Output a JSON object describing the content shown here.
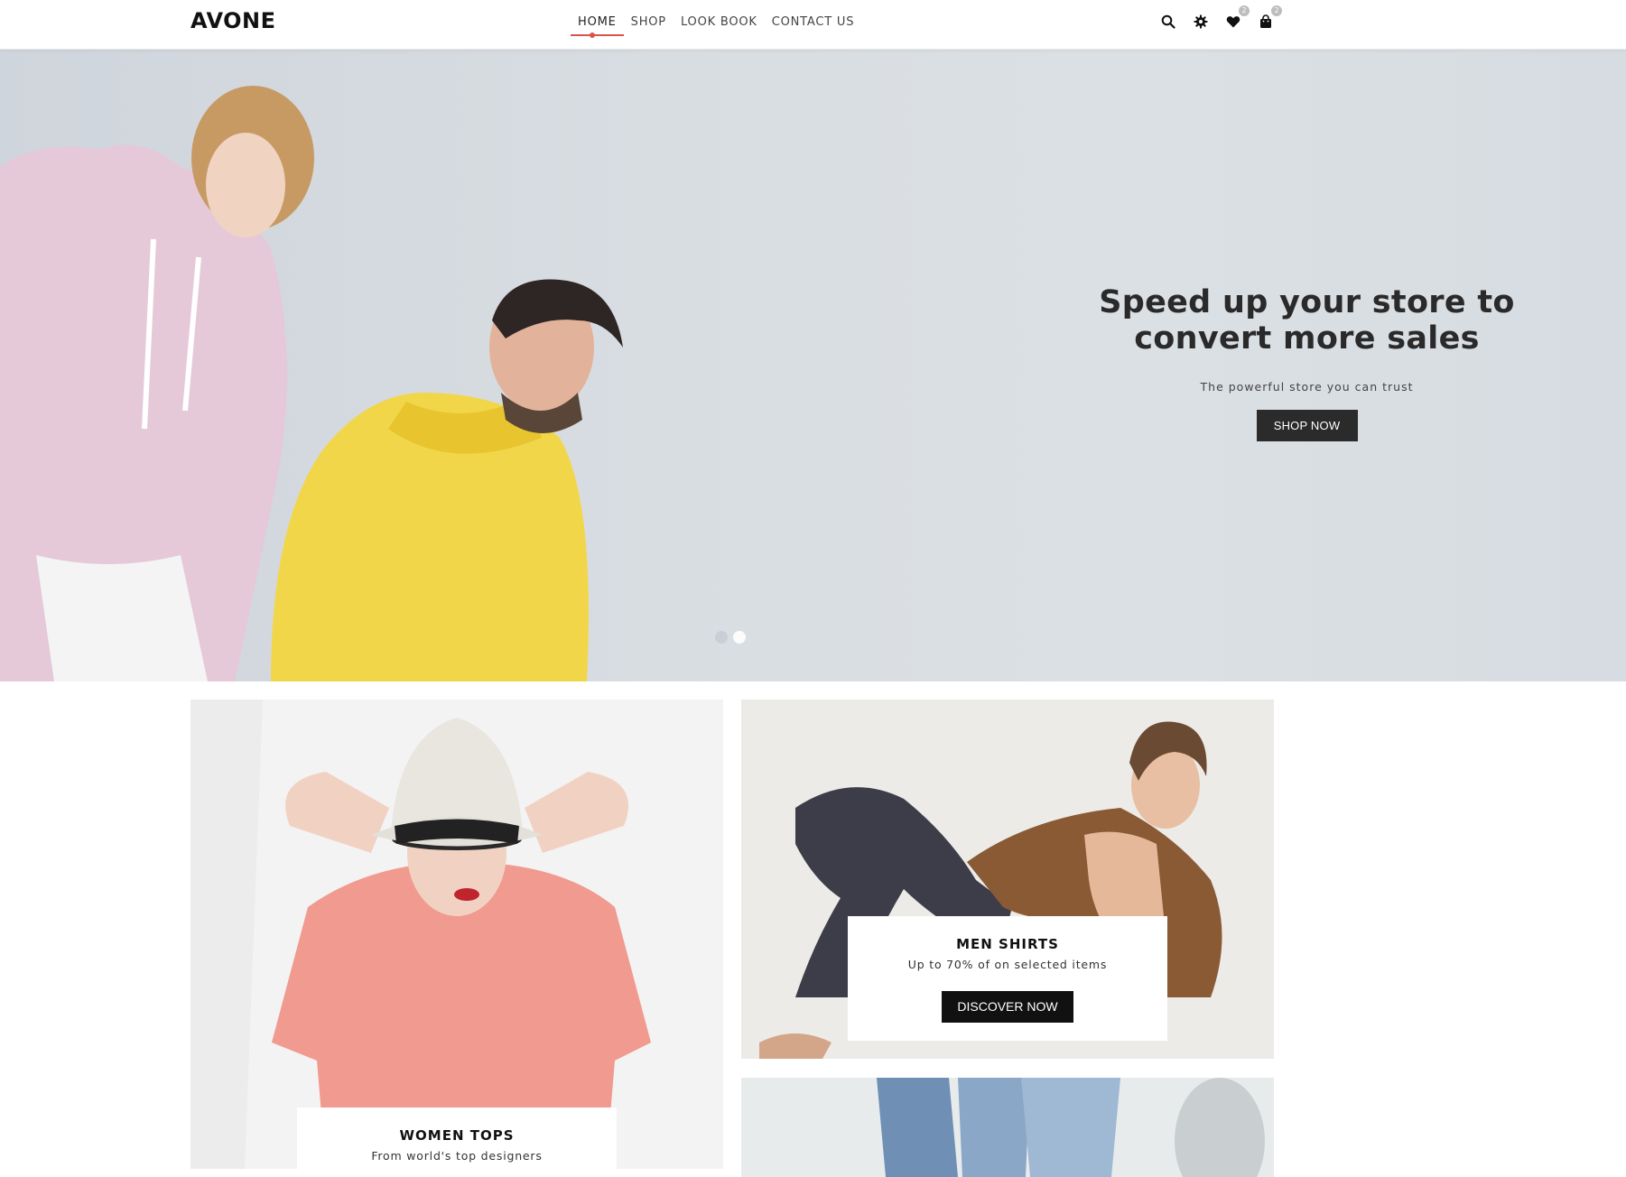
{
  "header": {
    "logo": "AVONE",
    "nav": [
      {
        "label": "HOME",
        "active": true
      },
      {
        "label": "SHOP",
        "active": false
      },
      {
        "label": "LOOK BOOK",
        "active": false
      },
      {
        "label": "CONTACT US",
        "active": false
      }
    ],
    "icons": {
      "search": "search-icon",
      "settings": "gear-icon",
      "wishlist": "heart-icon",
      "cart": "shopping-bag-icon"
    },
    "wishlist_count": "2",
    "cart_count": "2",
    "accent_color": "#d9534f"
  },
  "hero": {
    "title": "Speed up your store to convert more sales",
    "subtitle": "The powerful store you can trust",
    "button_label": "SHOP NOW",
    "slides": 2,
    "active_slide": 2
  },
  "banners": {
    "men": {
      "title": "MEN SHIRTS",
      "subtitle": "Up to 70% of on selected items",
      "button_label": "DISCOVER NOW"
    },
    "women": {
      "title": "WOMEN TOPS",
      "subtitle": "From world's top designers"
    }
  }
}
